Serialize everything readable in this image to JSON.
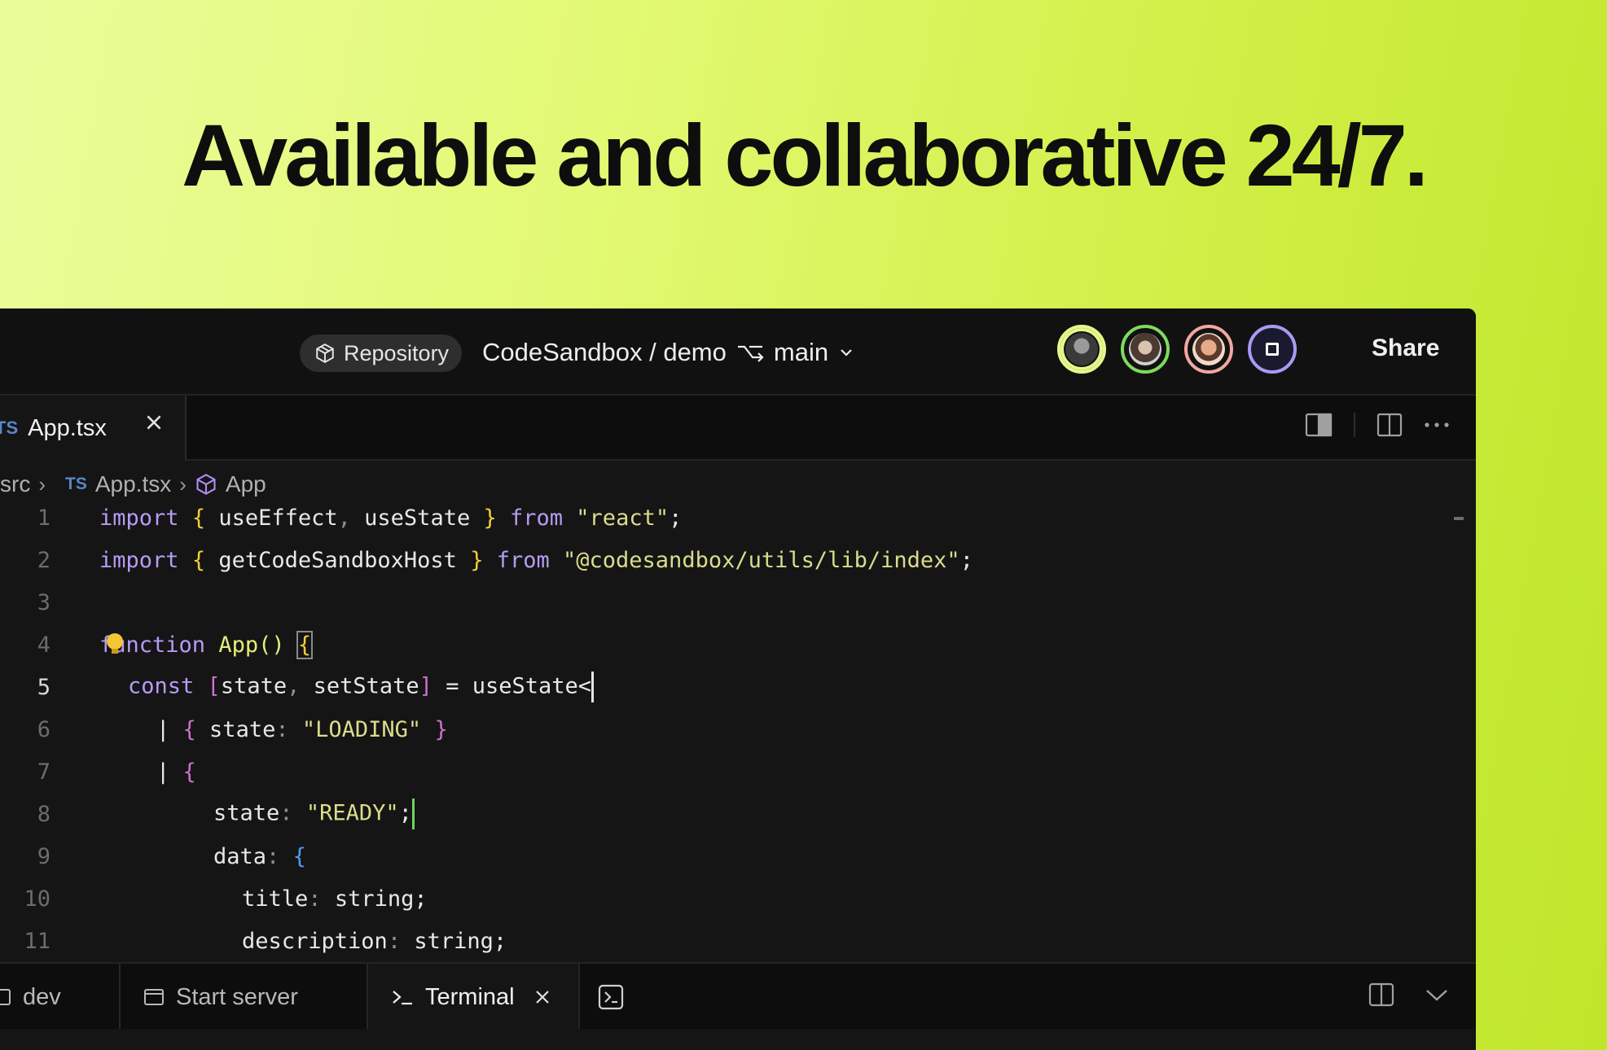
{
  "headline": "Available and collaborative 24/7.",
  "topbar": {
    "repo_badge": "Repository",
    "repo_path": "CodeSandbox / demo",
    "branch": "main",
    "share_label": "Share",
    "avatar_ring_colors": [
      "#e4f98a",
      "#7fdb5c",
      "#f2a6a0",
      "#a79bf3"
    ]
  },
  "tabs": {
    "active_tab_lang": "TS",
    "active_tab_name": "App.tsx"
  },
  "breadcrumb": {
    "folder": "src",
    "file_lang": "TS",
    "file": "App.tsx",
    "symbol": "App"
  },
  "code": {
    "line_numbers": [
      "1",
      "2",
      "3",
      "4",
      "5",
      "6",
      "7",
      "8",
      "9",
      "10",
      "11"
    ],
    "l1": {
      "kw1": "import",
      "ob": "{",
      "id1": " useEffect",
      "comma": ",",
      "id2": " useState ",
      "cb": "}",
      "kw2": "from",
      "str": "\"react\"",
      "semi": ";"
    },
    "l2": {
      "kw1": "import",
      "ob": "{",
      "id1": " getCodeSandboxHost ",
      "cb": "}",
      "kw2": "from",
      "str": "\"@codesandbox/utils/lib/index\"",
      "semi": ";"
    },
    "l4": {
      "kw": "function",
      "fn": "App()",
      "ob": "{"
    },
    "l5": {
      "kw": "const",
      "ob": "[",
      "a": "state",
      "comma": ",",
      "b": " setState",
      "cb": "]",
      "eq": " = useState<"
    },
    "l6": {
      "pipe": "|",
      "ob": "{",
      "key": " state",
      "colon": ":",
      "str": "\"LOADING\"",
      "cb": "}"
    },
    "l7": {
      "pipe": "|",
      "ob": "{"
    },
    "l8": {
      "key": "state",
      "colon": ":",
      "str": "\"READY\"",
      "semi": ";"
    },
    "l9": {
      "key": "data",
      "colon": ":",
      "ob": "{"
    },
    "l10": {
      "key": "title",
      "colon": ":",
      "type": "string;"
    },
    "l11": {
      "key": "description",
      "colon": ":",
      "type": "string;"
    }
  },
  "panel": {
    "tab_dev": "dev",
    "tab_start_server": "Start server",
    "tab_terminal": "Terminal"
  }
}
